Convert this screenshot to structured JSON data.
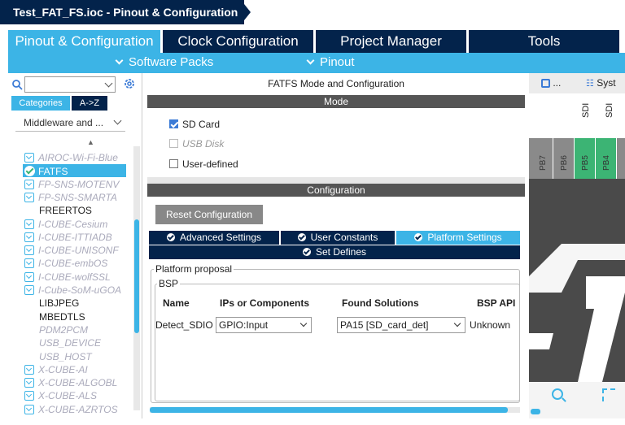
{
  "title": "Test_FAT_FS.ioc - Pinout & Configuration",
  "main_tabs": [
    {
      "label": "Pinout & Configuration",
      "active": true
    },
    {
      "label": "Clock Configuration",
      "active": false
    },
    {
      "label": "Project Manager",
      "active": false
    },
    {
      "label": "Tools",
      "active": false
    }
  ],
  "subbar": {
    "software_packs": "Software Packs",
    "pinout": "Pinout"
  },
  "left": {
    "search_placeholder": "",
    "cat_tabs": [
      {
        "label": "Categories",
        "active": true
      },
      {
        "label": "A->Z",
        "active": false
      }
    ],
    "category_select": "Middleware and ...",
    "items": [
      {
        "label": "AIROC-Wi-Fi-Blue",
        "style": "disabled"
      },
      {
        "label": "FATFS",
        "style": "selected"
      },
      {
        "label": "FP-SNS-MOTENV",
        "style": "disabled"
      },
      {
        "label": "FP-SNS-SMARTA",
        "style": "disabled"
      },
      {
        "label": "FREERTOS",
        "style": "plain"
      },
      {
        "label": "I-CUBE-Cesium",
        "style": "disabled"
      },
      {
        "label": "I-CUBE-ITTIADB",
        "style": "disabled"
      },
      {
        "label": "I-CUBE-UNISONF",
        "style": "disabled"
      },
      {
        "label": "I-CUBE-embOS",
        "style": "disabled"
      },
      {
        "label": "I-CUBE-wolfSSL",
        "style": "disabled"
      },
      {
        "label": "I-Cube-SoM-uGOA",
        "style": "disabled"
      },
      {
        "label": "LIBJPEG",
        "style": "plain"
      },
      {
        "label": "MBEDTLS",
        "style": "plain"
      },
      {
        "label": "PDM2PCM",
        "style": "plain-gray"
      },
      {
        "label": "USB_DEVICE",
        "style": "plain-gray"
      },
      {
        "label": "USB_HOST",
        "style": "plain-gray"
      },
      {
        "label": "X-CUBE-AI",
        "style": "disabled"
      },
      {
        "label": "X-CUBE-ALGOBL",
        "style": "disabled"
      },
      {
        "label": "X-CUBE-ALS",
        "style": "disabled"
      },
      {
        "label": "X-CUBE-AZRTOS",
        "style": "disabled"
      }
    ]
  },
  "center": {
    "panel_title": "FATFS Mode and Configuration",
    "mode_header": "Mode",
    "modes": [
      {
        "label": "SD Card",
        "checked": true,
        "enabled": true
      },
      {
        "label": "USB Disk",
        "checked": false,
        "enabled": false
      },
      {
        "label": "User-defined",
        "checked": false,
        "enabled": true
      }
    ],
    "config_header": "Configuration",
    "reset_button": "Reset Configuration",
    "settings_tabs": [
      {
        "label": "Advanced Settings",
        "active": false
      },
      {
        "label": "User Constants",
        "active": false
      },
      {
        "label": "Platform Settings",
        "active": true
      },
      {
        "label": "Set Defines",
        "active": false
      }
    ],
    "platform_legend": "Platform proposal",
    "bsp_legend": "BSP",
    "table_headers": [
      "Name",
      "IPs or Components",
      "Found Solutions",
      "BSP API"
    ],
    "row": {
      "name": "Detect_SDIO",
      "ip": "GPIO:Input",
      "solution": "PA15 [SD_card_det]",
      "api": "Unknown"
    }
  },
  "right": {
    "tab1": "...",
    "tab2": "Syst",
    "top_labels": [
      "SDI",
      "SDI"
    ],
    "pins": [
      {
        "label": "PB7",
        "color": "#8a8a8a"
      },
      {
        "label": "PB6",
        "color": "#8a8a8a"
      },
      {
        "label": "PB5",
        "color": "#3cb474"
      },
      {
        "label": "PB4",
        "color": "#3cb474"
      }
    ]
  },
  "colors": {
    "accent": "#3cb4e6",
    "navy": "#03234b",
    "green": "#3cb474"
  }
}
